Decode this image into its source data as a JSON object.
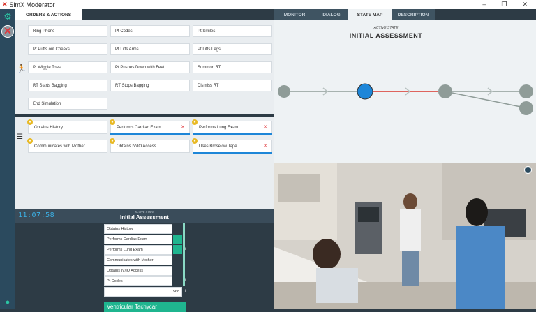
{
  "window": {
    "title": "SimX Moderator",
    "controls": [
      "–",
      "❐",
      "✕"
    ]
  },
  "sidebar": {
    "icons": [
      "gear-icon",
      "close-icon",
      "mic-icon"
    ]
  },
  "left": {
    "tab_label": "ORDERS & ACTIONS",
    "actions": [
      [
        "Ring Phone",
        "Pt Codes",
        "Pt Smiles"
      ],
      [
        "Pt Puffs out Cheeks",
        "Pt Lifts Arms",
        "Pt Lifts Legs"
      ],
      [
        "Pt Wiggle Toes",
        "Pt Pushes Down with Feet",
        "Summon RT"
      ],
      [
        "RT Starts Bagging",
        "RT Stops Bagging",
        "Dismiss RT"
      ],
      [
        "End Simulation"
      ]
    ],
    "checklist": [
      {
        "label": "Obtains History",
        "x": false,
        "blue": false
      },
      {
        "label": "Performs Cardiac Exam",
        "x": true,
        "blue": true
      },
      {
        "label": "Performs Lung Exam",
        "x": true,
        "blue": true
      },
      {
        "label": "Communicates with Mother",
        "x": false,
        "blue": false
      },
      {
        "label": "Obtains IV/IO Access",
        "x": false,
        "blue": false
      },
      {
        "label": "Uses Broselow Tape",
        "x": true,
        "blue": true
      }
    ]
  },
  "timeline": {
    "timer": "11:07:58",
    "active_state_label": "ACTIVE STATE",
    "state_name": "Initial Assessment",
    "rows": [
      "Obtains History",
      "Performs Cardiac Exam",
      "Performs Lung Exam",
      "Communicates with Mother",
      "Obtains IV/IO Access",
      "Pt Codes"
    ],
    "slider_value": "568",
    "next_state": "Ventricular Tachycar"
  },
  "right": {
    "tabs": [
      "MONITOR",
      "DIALOG",
      "STATE MAP",
      "DESCRIPTION"
    ],
    "active_tab": "STATE MAP",
    "active_state_label": "ACTIVE STATE",
    "state_name": "INITIAL ASSESSMENT"
  },
  "colors": {
    "accent": "#1fb58f",
    "active_node": "#1d86d8",
    "path_red": "#d9342b",
    "node_gray": "#8f9c98"
  }
}
